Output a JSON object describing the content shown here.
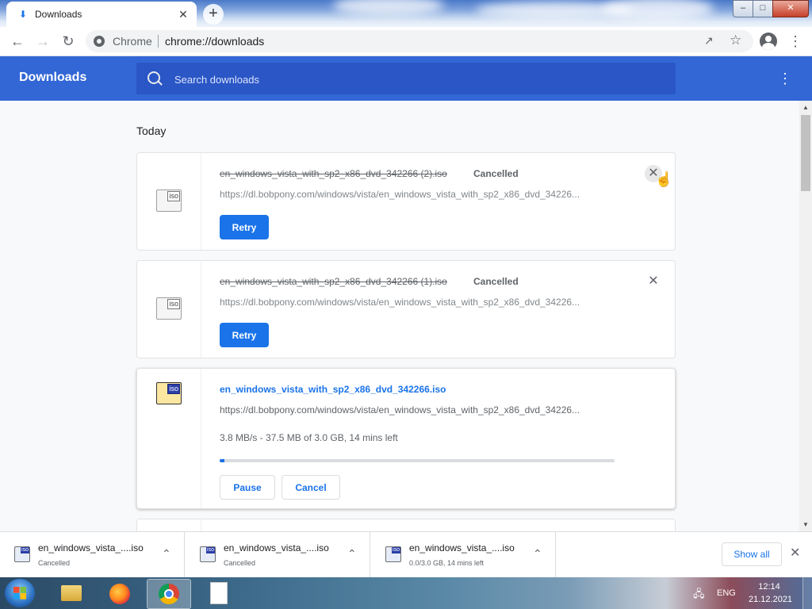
{
  "tab": {
    "icon": "download-icon",
    "title": "Downloads",
    "close_icon": "close-icon"
  },
  "toolbar": {
    "site_name": "Chrome",
    "url": "chrome://downloads",
    "back_icon": "back-arrow-icon",
    "forward_icon": "forward-arrow-icon",
    "reload_icon": "reload-icon",
    "share_icon": "share-icon",
    "bookmark_icon": "star-icon",
    "profile_icon": "avatar-icon",
    "menu_icon": "more-vert-icon"
  },
  "header": {
    "title": "Downloads",
    "search_placeholder": "Search downloads",
    "menu_icon": "more-vert-icon"
  },
  "main": {
    "section_label": "Today",
    "downloads": [
      {
        "filename": "en_windows_vista_with_sp2_x86_dvd_342266 (2).iso",
        "status": "Cancelled",
        "url": "https://dl.bobpony.com/windows/vista/en_windows_vista_with_sp2_x86_dvd_34226...",
        "action": "Retry",
        "icon_tag": "iso"
      },
      {
        "filename": "en_windows_vista_with_sp2_x86_dvd_342266 (1).iso",
        "status": "Cancelled",
        "url": "https://dl.bobpony.com/windows/vista/en_windows_vista_with_sp2_x86_dvd_34226...",
        "action": "Retry",
        "icon_tag": "iso"
      },
      {
        "filename": "en_windows_vista_with_sp2_x86_dvd_342266.iso",
        "url": "https://dl.bobpony.com/windows/vista/en_windows_vista_with_sp2_x86_dvd_34226...",
        "progress_text": "3.8 MB/s - 37.5 MB of 3.0 GB, 14 mins left",
        "progress_fraction": 0.0122,
        "pause_label": "Pause",
        "cancel_label": "Cancel",
        "icon_tag": "iso"
      }
    ]
  },
  "shelf": {
    "items": [
      {
        "name": "en_windows_vista_....iso",
        "status": "Cancelled",
        "icon_tag": "iso"
      },
      {
        "name": "en_windows_vista_....iso",
        "status": "Cancelled",
        "icon_tag": "iso"
      },
      {
        "name": "en_windows_vista_....iso",
        "status": "0.0/3.0 GB, 14 mins left",
        "icon_tag": "iso"
      }
    ],
    "show_all_label": "Show all"
  },
  "taskbar": {
    "language": "ENG",
    "time": "12:14",
    "date": "21.12.2021"
  },
  "colors": {
    "accent": "#1a73e8",
    "header_bg": "#3367d6",
    "search_bg": "#2a56c6"
  }
}
